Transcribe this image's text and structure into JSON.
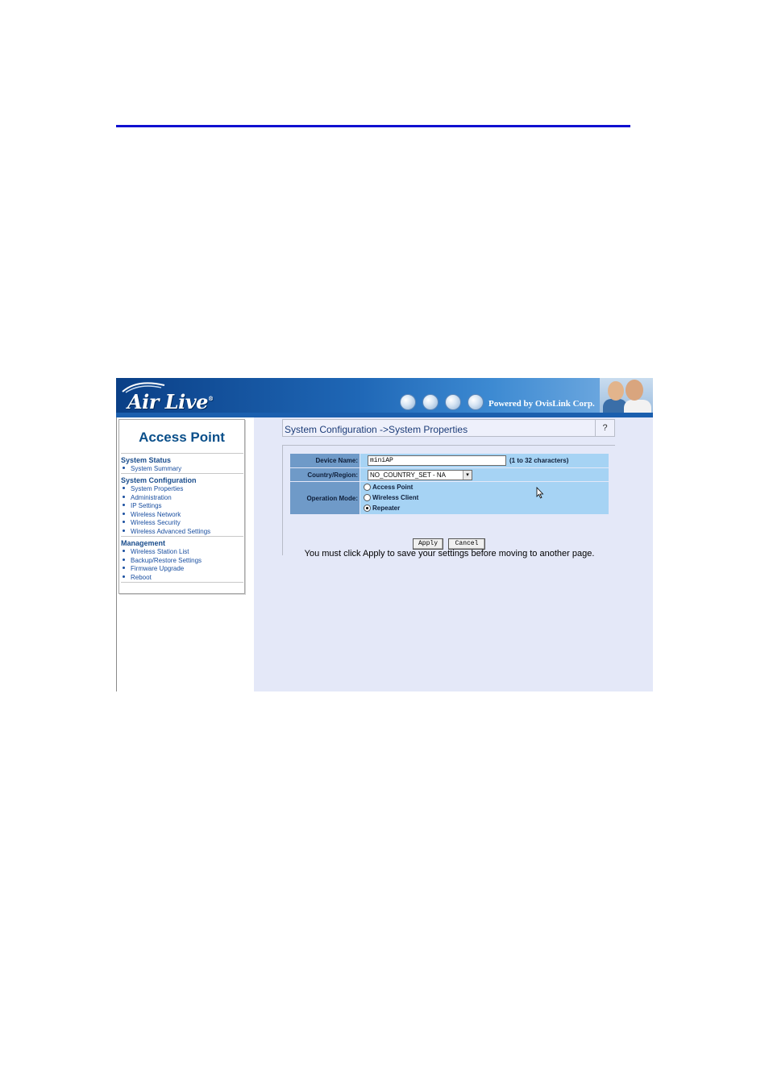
{
  "header": {
    "logo_text": "Air Live",
    "logo_mark": "®",
    "powered_by": "Powered by OvisLink Corp."
  },
  "sidebar": {
    "title": "Access Point",
    "sections": [
      {
        "heading": "System Status",
        "items": [
          "System Summary"
        ]
      },
      {
        "heading": "System Configuration",
        "items": [
          "System Properties",
          "Administration",
          "IP Settings",
          "Wireless Network",
          "Wireless Security",
          "Wireless Advanced Settings"
        ]
      },
      {
        "heading": "Management",
        "items": [
          "Wireless Station List",
          "Backup/Restore Settings",
          "Firmware Upgrade",
          "Reboot"
        ]
      }
    ]
  },
  "main": {
    "title": "System Configuration ->System Properties",
    "help_label": "?",
    "form": {
      "device_name_label": "Device Name:",
      "device_name_value": "miniAP",
      "device_name_hint": "(1 to 32 characters)",
      "country_label": "Country/Region:",
      "country_value": "NO_COUNTRY_SET - NA",
      "mode_label": "Operation Mode:",
      "modes": [
        "Access Point",
        "Wireless Client",
        "Repeater"
      ],
      "selected_mode": "Repeater"
    },
    "apply_label": "Apply",
    "cancel_label": "Cancel",
    "note": "You must click Apply to save your settings before moving to another page."
  },
  "colors": {
    "rule": "#1010d0",
    "banner": "#1f67b6",
    "content_bg": "#e4e8f8",
    "label_bg": "#6f9ac8",
    "field_bg": "#a6d3f4",
    "nav_link": "#1a4fa0"
  }
}
